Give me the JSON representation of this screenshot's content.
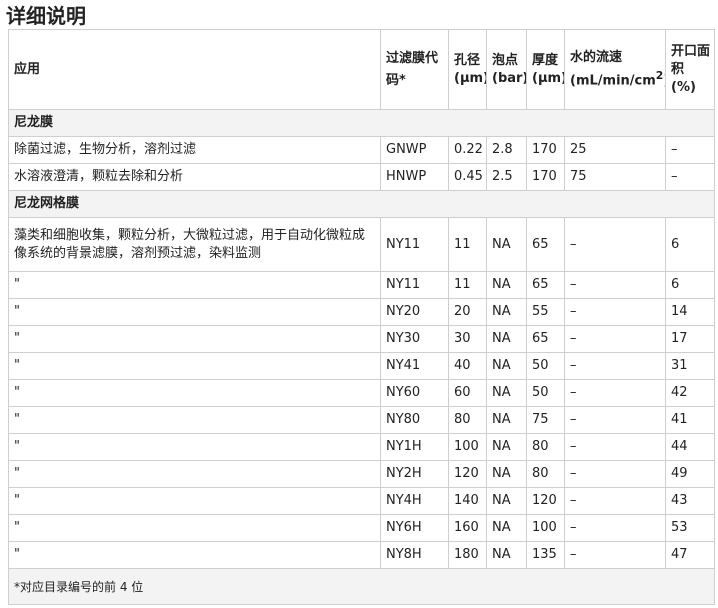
{
  "title": "详细说明",
  "headers": {
    "application": "应用",
    "code": "过滤膜代码*",
    "pore_1": "孔径",
    "pore_2": "(μm)",
    "bubble_1": "泡点",
    "bubble_2": "(bar)",
    "thick_1": "厚度",
    "thick_2": "(μm)",
    "flow_1": "水的流速",
    "flow_2": "(mL/min/cm",
    "flow_sup": "2",
    "flow_3": ")",
    "open_1": "开口面",
    "open_2": "积",
    "open_3": "(%)"
  },
  "sections": [
    {
      "name": "尼龙膜",
      "rows": [
        {
          "app": "除菌过滤，生物分析，溶剂过滤",
          "code": "GNWP",
          "pore": "0.22",
          "bubble": "2.8",
          "thick": "170",
          "flow": "25",
          "open": "–"
        },
        {
          "app": "水溶液澄清，颗粒去除和分析",
          "code": "HNWP",
          "pore": "0.45",
          "bubble": "2.5",
          "thick": "170",
          "flow": "75",
          "open": "–"
        }
      ]
    },
    {
      "name": "尼龙网格膜",
      "rows": [
        {
          "app": "藻类和细胞收集，颗粒分析，大微粒过滤，用于自动化微粒成像系统的背景滤膜，溶剂预过滤，染料监测",
          "code": "NY11",
          "pore": "11",
          "bubble": "NA",
          "thick": "65",
          "flow": "–",
          "open": "6"
        },
        {
          "app": "\"",
          "code": "NY11",
          "pore": "11",
          "bubble": "NA",
          "thick": "65",
          "flow": "–",
          "open": "6"
        },
        {
          "app": "\"",
          "code": "NY20",
          "pore": "20",
          "bubble": "NA",
          "thick": "55",
          "flow": "–",
          "open": "14"
        },
        {
          "app": "\"",
          "code": "NY30",
          "pore": "30",
          "bubble": "NA",
          "thick": "65",
          "flow": "–",
          "open": "17"
        },
        {
          "app": "\"",
          "code": "NY41",
          "pore": "40",
          "bubble": "NA",
          "thick": "50",
          "flow": "–",
          "open": "31"
        },
        {
          "app": "\"",
          "code": "NY60",
          "pore": "60",
          "bubble": "NA",
          "thick": "50",
          "flow": "–",
          "open": "42"
        },
        {
          "app": "\"",
          "code": "NY80",
          "pore": "80",
          "bubble": "NA",
          "thick": "75",
          "flow": "–",
          "open": "41"
        },
        {
          "app": "\"",
          "code": "NY1H",
          "pore": "100",
          "bubble": "NA",
          "thick": "80",
          "flow": "–",
          "open": "44"
        },
        {
          "app": "\"",
          "code": "NY2H",
          "pore": "120",
          "bubble": "NA",
          "thick": "80",
          "flow": "–",
          "open": "49"
        },
        {
          "app": "\"",
          "code": "NY4H",
          "pore": "140",
          "bubble": "NA",
          "thick": "120",
          "flow": "–",
          "open": "43"
        },
        {
          "app": "\"",
          "code": "NY6H",
          "pore": "160",
          "bubble": "NA",
          "thick": "100",
          "flow": "–",
          "open": "53"
        },
        {
          "app": "\"",
          "code": "NY8H",
          "pore": "180",
          "bubble": "NA",
          "thick": "135",
          "flow": "–",
          "open": "47"
        }
      ]
    }
  ],
  "footnote": "*对应目录编号的前 4 位"
}
